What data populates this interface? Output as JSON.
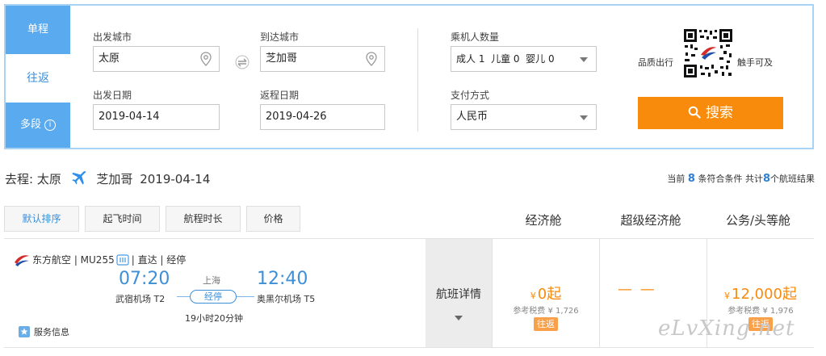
{
  "tabs": [
    "单程",
    "往返",
    "多段"
  ],
  "form": {
    "from_label": "出发城市",
    "from_value": "太原",
    "to_label": "到达城市",
    "to_value": "芝加哥",
    "depart_label": "出发日期",
    "depart_value": "2019-04-14",
    "return_label": "返程日期",
    "return_value": "2019-04-26",
    "pax_label": "乘机人数量",
    "pax_value": "成人 1  儿童 0  婴儿 0",
    "pay_label": "支付方式",
    "pay_value": "人民币"
  },
  "promo": {
    "left": "品质出行",
    "right": "触手可及"
  },
  "search_button": "搜索",
  "route": {
    "prefix": "去程:",
    "from": "太原",
    "to": "芝加哥",
    "date": "2019-04-14"
  },
  "result_count": {
    "p1": "当前",
    "n1": "8",
    "p2": "条符合条件 共计",
    "n2": "8",
    "p3": "个航班结果"
  },
  "sort_buttons": [
    "默认排序",
    "起飞时间",
    "航程时长",
    "价格"
  ],
  "cabins": [
    "经济舱",
    "超级经济舱",
    "公务/头等舱"
  ],
  "flight": {
    "airline_text": "东方航空 | MU255",
    "flags": "| 直达 | 经停",
    "dep_time": "07:20",
    "arr_time": "12:40",
    "dep_airport": "武宿机场 T2",
    "arr_airport": "奥黑尔机场 T5",
    "stop_city": "上海",
    "stop_tag": "经停",
    "duration": "19小时20分钟",
    "service": "服务信息",
    "detail": "航班详情",
    "economy_price": "0起",
    "economy_tax": "参考税费 ¥ 1,726",
    "super_economy": "— —",
    "business_price": "12,000起",
    "business_tax": "参考税费 ¥ 1,976",
    "yen": "¥",
    "rt_badge": "往返"
  },
  "watermark": "eLvXing.net",
  "colors": {
    "brand_blue": "#5aaaf0",
    "accent_orange": "#f98b0c",
    "link_blue": "#3d8fd8"
  }
}
